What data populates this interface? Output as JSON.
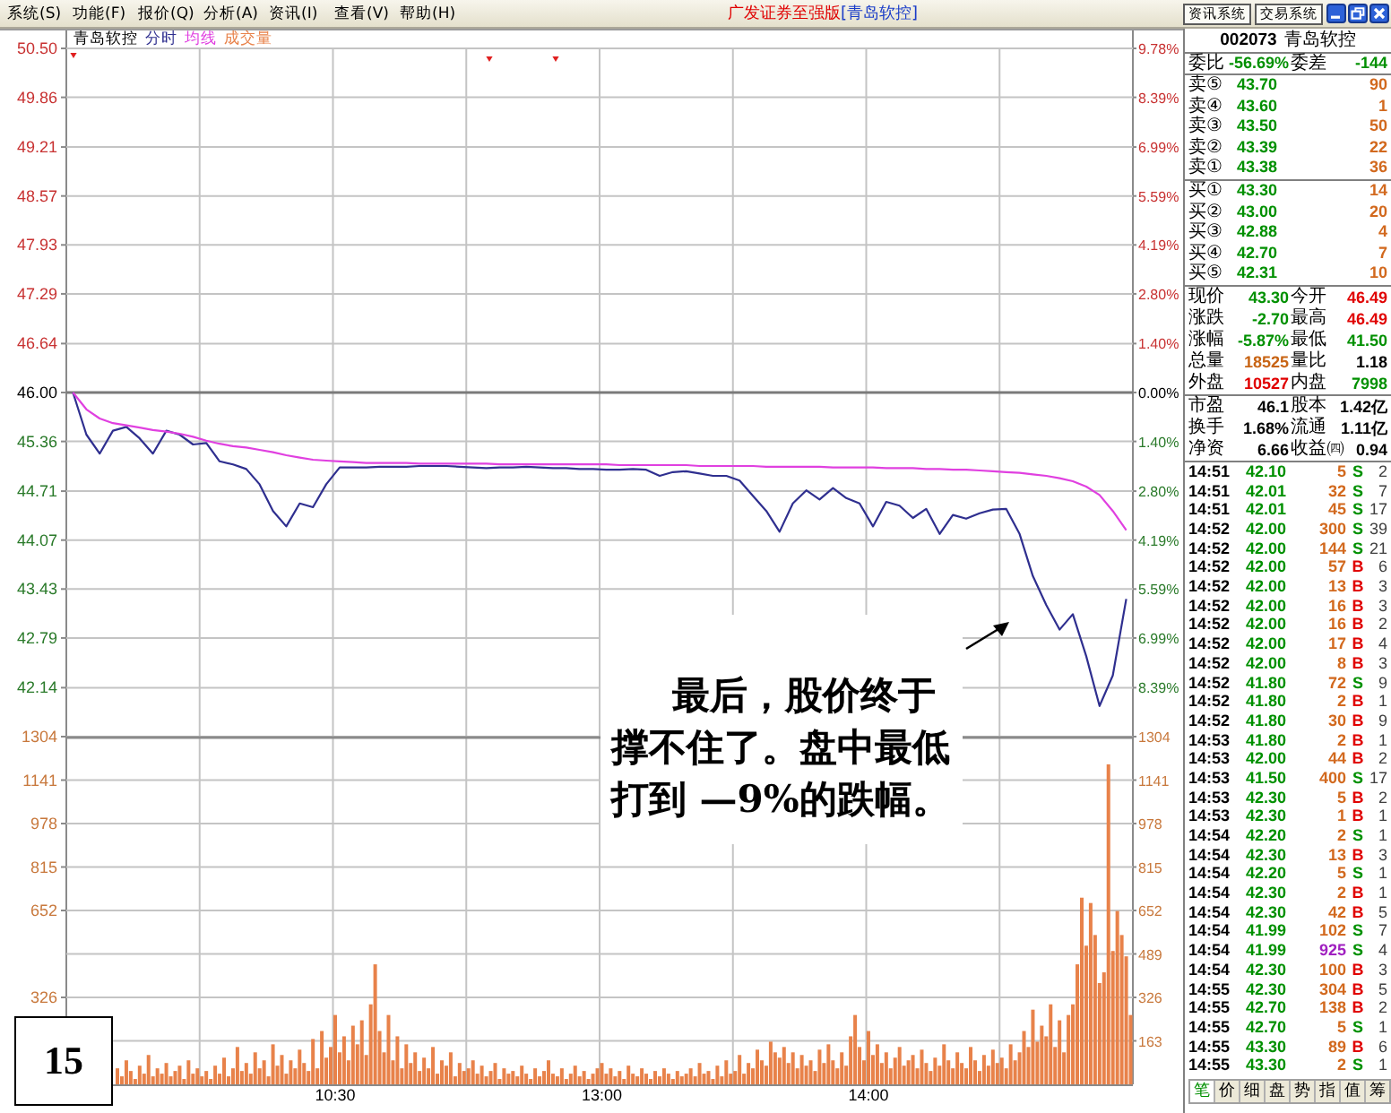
{
  "title_bar": {
    "menu": [
      "系统(S)",
      "功能(F)",
      "报价(Q)",
      "分析(A)",
      "资讯(I)",
      "查看(V)",
      "帮助(H)"
    ],
    "app_title": "广发证券至强版",
    "stock_title": "[青岛软控]",
    "buttons": [
      "资讯系统",
      "交易系统"
    ]
  },
  "chart": {
    "price_panel": {
      "chart_data": {
        "type": "line",
        "title": "青岛软控",
        "grid": true,
        "categories": [
          null,
          null,
          null,
          null,
          null,
          null,
          null,
          null,
          null,
          null,
          null,
          null,
          null,
          null,
          null,
          null,
          null,
          null,
          null,
          null,
          null,
          null,
          null,
          null,
          null,
          null,
          null,
          null,
          null,
          null,
          null,
          null,
          null,
          null,
          null,
          null,
          null,
          null,
          null,
          null,
          null,
          null,
          null,
          null,
          null,
          null,
          null,
          null,
          null,
          null,
          null,
          null,
          null,
          null,
          null,
          null,
          null,
          null,
          null,
          null,
          null,
          null,
          null,
          null,
          null,
          null,
          null,
          null,
          null,
          null,
          null,
          null,
          null,
          null,
          null,
          null,
          null,
          null,
          null,
          null
        ],
        "series": [
          {
            "name": "分时",
            "color": "#2f2f8f",
            "values": [
              46.0,
              45.45,
              45.2,
              45.5,
              45.55,
              45.4,
              45.2,
              45.5,
              45.45,
              45.32,
              45.34,
              45.1,
              45.06,
              45.0,
              44.8,
              44.45,
              44.25,
              44.55,
              44.5,
              44.8,
              45.02,
              45.02,
              45.02,
              45.03,
              45.03,
              45.03,
              45.04,
              45.04,
              45.04,
              45.03,
              45.02,
              45.01,
              45.02,
              45.02,
              45.03,
              45.02,
              45.01,
              45.01,
              45.0,
              45.0,
              44.99,
              44.99,
              45.0,
              44.99,
              44.91,
              44.96,
              44.97,
              44.94,
              44.91,
              44.91,
              44.85,
              44.65,
              44.45,
              44.18,
              44.55,
              44.72,
              44.6,
              44.75,
              44.62,
              44.55,
              44.25,
              44.57,
              44.52,
              44.36,
              44.48,
              44.15,
              44.4,
              44.35,
              44.42,
              44.47,
              44.48,
              44.15,
              43.6,
              43.22,
              42.9,
              43.1,
              42.55,
              41.9,
              42.3,
              43.3
            ]
          },
          {
            "name": "均线",
            "color": "#e040e0",
            "values": [
              46.0,
              45.78,
              45.66,
              45.6,
              45.57,
              45.54,
              45.51,
              45.49,
              45.46,
              45.42,
              45.37,
              45.33,
              45.3,
              45.28,
              45.25,
              45.22,
              45.18,
              45.15,
              45.12,
              45.11,
              45.1,
              45.09,
              45.08,
              45.08,
              45.08,
              45.08,
              45.07,
              45.07,
              45.07,
              45.07,
              45.07,
              45.07,
              45.06,
              45.06,
              45.06,
              45.06,
              45.06,
              45.06,
              45.06,
              45.06,
              45.06,
              45.05,
              45.05,
              45.05,
              45.05,
              45.05,
              45.05,
              45.04,
              45.04,
              45.04,
              45.04,
              45.04,
              45.03,
              45.03,
              45.03,
              45.03,
              45.03,
              45.02,
              45.02,
              45.02,
              45.02,
              45.01,
              45.01,
              45.01,
              45.0,
              45.0,
              44.99,
              44.99,
              44.98,
              44.97,
              44.96,
              44.95,
              44.93,
              44.91,
              44.88,
              44.84,
              44.77,
              44.66,
              44.45,
              44.2
            ]
          }
        ],
        "ylim": [
          41.5,
          50.5
        ],
        "yticks": [
          {
            "value": 50.5,
            "label": "50.50"
          },
          {
            "value": 49.86,
            "label": "49.86"
          },
          {
            "value": 49.21,
            "label": "49.21"
          },
          {
            "value": 48.57,
            "label": "48.57"
          },
          {
            "value": 47.93,
            "label": "47.93"
          },
          {
            "value": 47.29,
            "label": "47.29"
          },
          {
            "value": 46.64,
            "label": "46.64"
          },
          {
            "value": 46.0,
            "label": "46.00"
          },
          {
            "value": 45.36,
            "label": "45.36"
          },
          {
            "value": 44.71,
            "label": "44.71"
          },
          {
            "value": 44.07,
            "label": "44.07"
          },
          {
            "value": 43.43,
            "label": "43.43"
          },
          {
            "value": 42.79,
            "label": "42.79"
          },
          {
            "value": 42.14,
            "label": "42.14"
          }
        ],
        "ref_lines": [
          {
            "axis": "y",
            "value": 46.0
          }
        ]
      },
      "percent_ticks": [
        {
          "label": "9.78%",
          "color": "#c83232"
        },
        {
          "label": "8.39%",
          "color": "#c83232"
        },
        {
          "label": "6.99%",
          "color": "#c83232"
        },
        {
          "label": "5.59%",
          "color": "#c83232"
        },
        {
          "label": "4.19%",
          "color": "#c83232"
        },
        {
          "label": "2.80%",
          "color": "#c83232"
        },
        {
          "label": "1.40%",
          "color": "#c83232"
        },
        {
          "label": "0.00%",
          "color": "#000000"
        },
        {
          "label": "1.40%",
          "color": "#2a7a2a"
        },
        {
          "label": "2.80%",
          "color": "#2a7a2a"
        },
        {
          "label": "4.19%",
          "color": "#2a7a2a"
        },
        {
          "label": "5.59%",
          "color": "#2a7a2a"
        },
        {
          "label": "6.99%",
          "color": "#2a7a2a"
        },
        {
          "label": "8.39%",
          "color": "#2a7a2a"
        }
      ]
    },
    "volume_panel": {
      "chart_data": {
        "type": "bar",
        "grid": true,
        "categories": [
          null,
          null,
          null,
          null,
          null,
          null,
          null,
          null,
          null,
          null,
          null,
          null,
          null,
          null,
          null,
          null,
          null,
          null,
          null,
          null,
          null,
          null,
          null,
          null,
          null,
          null,
          null,
          null,
          null,
          null,
          null,
          null,
          null,
          null,
          null,
          null,
          null,
          null,
          null,
          null,
          null,
          null,
          null,
          null,
          null,
          null,
          null,
          null,
          null,
          null,
          null,
          null,
          null,
          null,
          null,
          null,
          null,
          null,
          null,
          null,
          "10:30",
          null,
          null,
          null,
          null,
          null,
          null,
          null,
          null,
          null,
          null,
          null,
          null,
          null,
          null,
          null,
          null,
          null,
          null,
          null,
          null,
          null,
          null,
          null,
          null,
          null,
          null,
          null,
          null,
          null,
          null,
          null,
          null,
          null,
          null,
          null,
          null,
          null,
          null,
          null,
          null,
          null,
          null,
          null,
          null,
          null,
          null,
          null,
          null,
          null,
          null,
          null,
          null,
          null,
          null,
          null,
          null,
          null,
          null,
          null,
          "13:00",
          null,
          null,
          null,
          null,
          null,
          null,
          null,
          null,
          null,
          null,
          null,
          null,
          null,
          null,
          null,
          null,
          null,
          null,
          null,
          null,
          null,
          null,
          null,
          null,
          null,
          null,
          null,
          null,
          null,
          null,
          null,
          null,
          null,
          null,
          null,
          null,
          null,
          null,
          null,
          null,
          null,
          null,
          null,
          null,
          null,
          null,
          null,
          null,
          null,
          null,
          null,
          null,
          null,
          null,
          null,
          null,
          null,
          null,
          null,
          "14:00",
          null,
          null,
          null,
          null,
          null,
          null,
          null,
          null,
          null,
          null,
          null,
          null,
          null,
          null,
          null,
          null,
          null,
          null,
          null,
          null,
          null,
          null,
          null,
          null,
          null,
          null,
          null,
          null,
          null,
          null,
          null,
          null,
          null,
          null,
          null,
          null,
          null,
          null,
          null,
          null,
          null,
          null,
          null,
          null,
          null,
          null,
          null,
          null,
          null,
          null,
          null,
          null,
          null,
          null,
          null,
          null,
          null,
          null,
          null
        ],
        "series": [
          {
            "name": "成交量",
            "color": "#e8824a",
            "values": [
              null,
              null,
              null,
              null,
              null,
              null,
              null,
              null,
              null,
              null,
              null,
              60,
              30,
              90,
              50,
              20,
              70,
              40,
              110,
              30,
              60,
              40,
              80,
              30,
              50,
              70,
              20,
              90,
              40,
              60,
              30,
              50,
              20,
              70,
              40,
              100,
              30,
              60,
              140,
              50,
              80,
              40,
              120,
              60,
              90,
              30,
              150,
              70,
              110,
              40,
              90,
              60,
              130,
              80,
              50,
              170,
              60,
              200,
              100,
              140,
              260,
              120,
              180,
              90,
              220,
              150,
              240,
              110,
              300,
              450,
              200,
              120,
              260,
              90,
              180,
              60,
              150,
              80,
              120,
              50,
              100,
              60,
              140,
              40,
              90,
              70,
              120,
              30,
              80,
              50,
              60,
              90,
              40,
              70,
              30,
              50,
              80,
              20,
              60,
              40,
              50,
              30,
              70,
              40,
              20,
              60,
              30,
              50,
              90,
              40,
              30,
              60,
              20,
              40,
              70,
              30,
              50,
              20,
              40,
              60,
              80,
              40,
              60,
              30,
              50,
              20,
              70,
              40,
              30,
              60,
              40,
              20,
              50,
              30,
              60,
              40,
              20,
              50,
              30,
              40,
              60,
              30,
              80,
              40,
              50,
              20,
              70,
              30,
              90,
              40,
              50,
              110,
              40,
              80,
              60,
              130,
              90,
              70,
              160,
              120,
              100,
              140,
              80,
              120,
              60,
              110,
              70,
              90,
              50,
              130,
              80,
              150,
              90,
              60,
              120,
              70,
              180,
              260,
              140,
              90,
              200,
              110,
              150,
              80,
              120,
              60,
              100,
              140,
              70,
              90,
              110,
              60,
              130,
              80,
              50,
              100,
              70,
              150,
              90,
              60,
              120,
              80,
              60,
              140,
              90,
              50,
              110,
              70,
              130,
              80,
              100,
              60,
              150,
              90,
              120,
              200,
              140,
              280,
              160,
              220,
              180,
              300,
              140,
              240,
              120,
              260,
              300,
              450,
              700,
              520,
              680,
              560,
              380,
              420,
              1200,
              500,
              650,
              560,
              480,
              260
            ]
          }
        ],
        "ylim": [
          0,
          1304
        ],
        "yticks": [
          1304,
          1141,
          978,
          815,
          652,
          326
        ]
      },
      "right_labels": [
        "1304",
        "1141",
        "978",
        "815",
        "652",
        "489",
        "326",
        "163"
      ]
    },
    "annotation": {
      "lines": [
        "最后，股价终于",
        "撑不住了。盘中最低",
        "打到 —9%的跌幅。"
      ]
    },
    "slide_number": "15"
  },
  "quote_panel": {
    "code": "002073",
    "name": "青岛软控",
    "order_ratio": [
      {
        "label": "委比",
        "value": "-56.69%"
      },
      {
        "label": "委差",
        "value": "-144"
      }
    ],
    "asks": [
      {
        "label": "卖⑤",
        "price": "43.70",
        "volume": "90"
      },
      {
        "label": "卖④",
        "price": "43.60",
        "volume": "1"
      },
      {
        "label": "卖③",
        "price": "43.50",
        "volume": "50"
      },
      {
        "label": "卖②",
        "price": "43.39",
        "volume": "22"
      },
      {
        "label": "卖①",
        "price": "43.38",
        "volume": "36"
      }
    ],
    "bids": [
      {
        "label": "买①",
        "price": "43.30",
        "volume": "14"
      },
      {
        "label": "买②",
        "price": "43.00",
        "volume": "20"
      },
      {
        "label": "买③",
        "price": "42.88",
        "volume": "4"
      },
      {
        "label": "买④",
        "price": "42.70",
        "volume": "7"
      },
      {
        "label": "买⑤",
        "price": "42.31",
        "volume": "10"
      }
    ],
    "stats": [
      {
        "label": "现价",
        "value": "43.30",
        "color": "#009000"
      },
      {
        "label": "今开",
        "value": "46.49",
        "color": "#e00000"
      },
      {
        "label": "涨跌",
        "value": "-2.70",
        "color": "#009000"
      },
      {
        "label": "最高",
        "value": "46.49",
        "color": "#e00000"
      },
      {
        "label": "涨幅",
        "value": "-5.87%",
        "color": "#009000"
      },
      {
        "label": "最低",
        "value": "41.50",
        "color": "#009000"
      },
      {
        "label": "总量",
        "value": "18525",
        "color": "#c86414"
      },
      {
        "label": "量比",
        "value": "1.18",
        "color": "#000000"
      },
      {
        "label": "外盘",
        "value": "10527",
        "color": "#e00000"
      },
      {
        "label": "内盘",
        "value": "7998",
        "color": "#009000"
      }
    ],
    "fundamentals": [
      {
        "label": "市盈",
        "value": "46.1"
      },
      {
        "label": "股本",
        "value": "1.42亿"
      },
      {
        "label": "换手",
        "value": "1.68%"
      },
      {
        "label": "流通",
        "value": "1.11亿"
      },
      {
        "label": "净资",
        "value": "6.66"
      },
      {
        "label": "收益㈣",
        "value": "0.94"
      }
    ],
    "ticks": [
      {
        "time": "14:51",
        "price": "42.10",
        "volume": "5",
        "side": "S",
        "count": "2",
        "color": "#009000",
        "large": false
      },
      {
        "time": "14:51",
        "price": "42.01",
        "volume": "32",
        "side": "S",
        "count": "7",
        "color": "#009000",
        "large": false
      },
      {
        "time": "14:51",
        "price": "42.01",
        "volume": "45",
        "side": "S",
        "count": "17",
        "color": "#009000",
        "large": false
      },
      {
        "time": "14:52",
        "price": "42.00",
        "volume": "300",
        "side": "S",
        "count": "39",
        "color": "#009000",
        "large": false
      },
      {
        "time": "14:52",
        "price": "42.00",
        "volume": "144",
        "side": "S",
        "count": "21",
        "color": "#009000",
        "large": false
      },
      {
        "time": "14:52",
        "price": "42.00",
        "volume": "57",
        "side": "B",
        "count": "6",
        "color": "#e00000",
        "large": false
      },
      {
        "time": "14:52",
        "price": "42.00",
        "volume": "13",
        "side": "B",
        "count": "3",
        "color": "#e00000",
        "large": false
      },
      {
        "time": "14:52",
        "price": "42.00",
        "volume": "16",
        "side": "B",
        "count": "3",
        "color": "#e00000",
        "large": false
      },
      {
        "time": "14:52",
        "price": "42.00",
        "volume": "16",
        "side": "B",
        "count": "2",
        "color": "#e00000",
        "large": false
      },
      {
        "time": "14:52",
        "price": "42.00",
        "volume": "17",
        "side": "B",
        "count": "4",
        "color": "#e00000",
        "large": false
      },
      {
        "time": "14:52",
        "price": "42.00",
        "volume": "8",
        "side": "B",
        "count": "3",
        "color": "#e00000",
        "large": false
      },
      {
        "time": "14:52",
        "price": "41.80",
        "volume": "72",
        "side": "S",
        "count": "9",
        "color": "#009000",
        "large": false
      },
      {
        "time": "14:52",
        "price": "41.80",
        "volume": "2",
        "side": "B",
        "count": "1",
        "color": "#e00000",
        "large": false
      },
      {
        "time": "14:52",
        "price": "41.80",
        "volume": "30",
        "side": "B",
        "count": "9",
        "color": "#e00000",
        "large": false
      },
      {
        "time": "14:53",
        "price": "41.80",
        "volume": "2",
        "side": "B",
        "count": "1",
        "color": "#e00000",
        "large": false
      },
      {
        "time": "14:53",
        "price": "42.00",
        "volume": "44",
        "side": "B",
        "count": "2",
        "color": "#e00000",
        "large": false
      },
      {
        "time": "14:53",
        "price": "41.50",
        "volume": "400",
        "side": "S",
        "count": "17",
        "color": "#009000",
        "large": false
      },
      {
        "time": "14:53",
        "price": "42.30",
        "volume": "5",
        "side": "B",
        "count": "2",
        "color": "#e00000",
        "large": false
      },
      {
        "time": "14:53",
        "price": "42.30",
        "volume": "1",
        "side": "B",
        "count": "1",
        "color": "#e00000",
        "large": false
      },
      {
        "time": "14:54",
        "price": "42.20",
        "volume": "2",
        "side": "S",
        "count": "1",
        "color": "#009000",
        "large": false
      },
      {
        "time": "14:54",
        "price": "42.30",
        "volume": "13",
        "side": "B",
        "count": "3",
        "color": "#e00000",
        "large": false
      },
      {
        "time": "14:54",
        "price": "42.20",
        "volume": "5",
        "side": "S",
        "count": "1",
        "color": "#009000",
        "large": false
      },
      {
        "time": "14:54",
        "price": "42.30",
        "volume": "2",
        "side": "B",
        "count": "1",
        "color": "#e00000",
        "large": false
      },
      {
        "time": "14:54",
        "price": "42.30",
        "volume": "42",
        "side": "B",
        "count": "5",
        "color": "#e00000",
        "large": false
      },
      {
        "time": "14:54",
        "price": "41.99",
        "volume": "102",
        "side": "S",
        "count": "7",
        "color": "#009000",
        "large": false
      },
      {
        "time": "14:54",
        "price": "41.99",
        "volume": "925",
        "side": "S",
        "count": "4",
        "color": "#009000",
        "large": true
      },
      {
        "time": "14:54",
        "price": "42.30",
        "volume": "100",
        "side": "B",
        "count": "3",
        "color": "#e00000",
        "large": false
      },
      {
        "time": "14:55",
        "price": "42.30",
        "volume": "304",
        "side": "B",
        "count": "5",
        "color": "#e00000",
        "large": false
      },
      {
        "time": "14:55",
        "price": "42.70",
        "volume": "138",
        "side": "B",
        "count": "2",
        "color": "#e00000",
        "large": false
      },
      {
        "time": "14:55",
        "price": "42.70",
        "volume": "5",
        "side": "S",
        "count": "1",
        "color": "#009000",
        "large": false
      },
      {
        "time": "14:55",
        "price": "43.30",
        "volume": "89",
        "side": "B",
        "count": "6",
        "color": "#e00000",
        "large": false
      },
      {
        "time": "14:55",
        "price": "43.30",
        "volume": "2",
        "side": "S",
        "count": "1",
        "color": "#009000",
        "large": false
      }
    ],
    "tabs": [
      {
        "label": "笔",
        "selected": true
      },
      {
        "label": "价",
        "selected": false
      },
      {
        "label": "细",
        "selected": false
      },
      {
        "label": "盘",
        "selected": false
      },
      {
        "label": "势",
        "selected": false
      },
      {
        "label": "指",
        "selected": false
      },
      {
        "label": "值",
        "selected": false
      },
      {
        "label": "筹",
        "selected": false
      }
    ]
  }
}
